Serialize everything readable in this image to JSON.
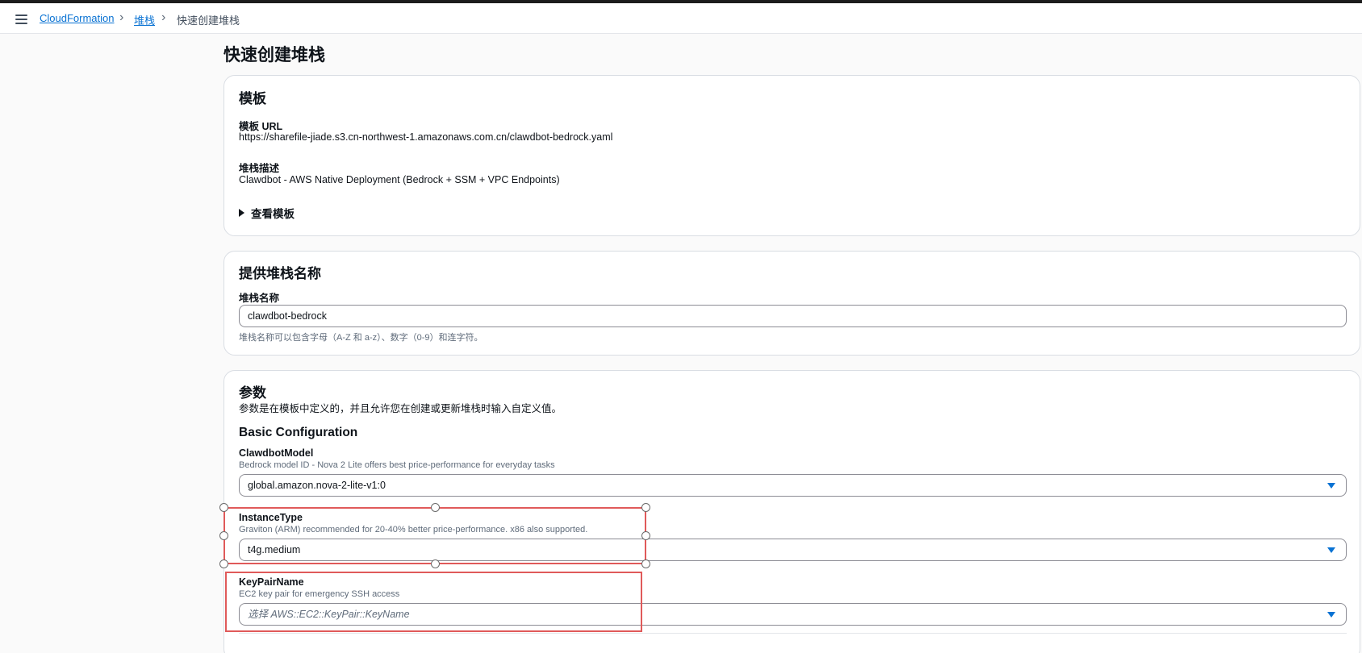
{
  "breadcrumb": {
    "items": [
      "CloudFormation",
      "堆栈"
    ],
    "current": "快速创建堆栈"
  },
  "page": {
    "title": "快速创建堆栈"
  },
  "template_panel": {
    "heading": "模板",
    "url_label": "模板 URL",
    "url_value": "https://sharefile-jiade.s3.cn-northwest-1.amazonaws.com.cn/clawdbot-bedrock.yaml",
    "desc_label": "堆栈描述",
    "desc_value": "Clawdbot - AWS Native Deployment (Bedrock + SSM + VPC Endpoints)",
    "view_template": "查看模板"
  },
  "stack_name_panel": {
    "heading": "提供堆栈名称",
    "label": "堆栈名称",
    "value": "clawdbot-bedrock",
    "hint": "堆栈名称可以包含字母（A-Z 和 a-z）、数字（0-9）和连字符。"
  },
  "params_panel": {
    "heading": "参数",
    "description": "参数是在模板中定义的，并且允许您在创建或更新堆栈时输入自定义值。",
    "group_title": "Basic Configuration",
    "params": [
      {
        "name": "ClawdbotModel",
        "description": "Bedrock model ID - Nova 2 Lite offers best price-performance for everyday tasks",
        "value": "global.amazon.nova-2-lite-v1:0"
      },
      {
        "name": "InstanceType",
        "description": "Graviton (ARM) recommended for 20-40% better price-performance. x86 also supported.",
        "value": "t4g.medium"
      },
      {
        "name": "KeyPairName",
        "description": "EC2 key pair for emergency SSH access",
        "placeholder": "选择 AWS::EC2::KeyPair::KeyName"
      }
    ]
  },
  "colors": {
    "link": "#0972d3",
    "highlight_border": "#e05a5a",
    "panel_border": "#d9dde3"
  }
}
